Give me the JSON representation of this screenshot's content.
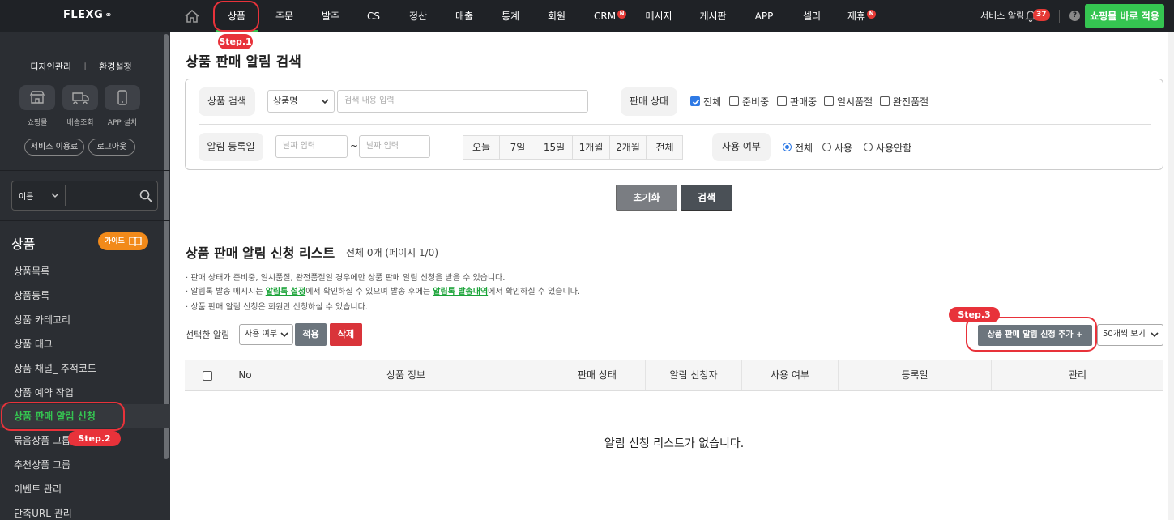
{
  "topbar": {
    "logo": "FLEXG",
    "nav": [
      {
        "label": "상품",
        "active": true
      },
      {
        "label": "주문"
      },
      {
        "label": "발주"
      },
      {
        "label": "CS"
      },
      {
        "label": "정산"
      },
      {
        "label": "매출"
      },
      {
        "label": "통계"
      },
      {
        "label": "회원"
      },
      {
        "label": "CRM",
        "badge": "N"
      },
      {
        "label": "메시지"
      },
      {
        "label": "게시판"
      },
      {
        "label": "APP"
      },
      {
        "label": "셀러"
      },
      {
        "label": "제휴",
        "badge": "N"
      }
    ],
    "service_alert": "서비스 알림",
    "alert_count": "37",
    "help": "?",
    "apply_shop": "쇼핑몰 바로 적용"
  },
  "sidebar": {
    "links": [
      "디자인관리",
      "환경설정"
    ],
    "icons": [
      {
        "label": "쇼핑몰",
        "icon": "store-icon"
      },
      {
        "label": "배송조회",
        "icon": "truck-icon"
      },
      {
        "label": "APP 설치",
        "icon": "phone-icon"
      }
    ],
    "pills": [
      "서비스 이용료",
      "로그아웃"
    ],
    "search_select": "이름",
    "section_title": "상품",
    "guide": "가이드",
    "items": [
      {
        "label": "상품목록"
      },
      {
        "label": "상품등록"
      },
      {
        "label": "상품 카테고리"
      },
      {
        "label": "상품 태그"
      },
      {
        "label": "상품 채널_ 추적코드"
      },
      {
        "label": "상품 예약 작업"
      },
      {
        "label": "상품 판매 알림 신청",
        "active": true
      },
      {
        "label": "묶음상품 그룹"
      },
      {
        "label": "추천상품 그룹"
      },
      {
        "label": "이벤트 관리"
      },
      {
        "label": "단축URL 관리"
      }
    ]
  },
  "main": {
    "title": "상품 판매 알림 검색",
    "search": {
      "product_search_label": "상품 검색",
      "product_select": "상품명",
      "keyword_placeholder": "검색 내용 입력",
      "status_label": "판매 상태",
      "status_options": [
        {
          "label": "전체",
          "checked": true
        },
        {
          "label": "준비중",
          "checked": false
        },
        {
          "label": "판매중",
          "checked": false
        },
        {
          "label": "일시품절",
          "checked": false
        },
        {
          "label": "완전품절",
          "checked": false
        }
      ],
      "date_label": "알림 등록일",
      "date_from_placeholder": "날짜 입력",
      "date_sep": "~",
      "date_to_placeholder": "날짜 입력",
      "date_buttons": [
        "오늘",
        "7일",
        "15일",
        "1개월",
        "2개월",
        "전체"
      ],
      "use_label": "사용 여부",
      "use_options": [
        {
          "label": "전체",
          "selected": true
        },
        {
          "label": "사용",
          "selected": false
        },
        {
          "label": "사용안함",
          "selected": false
        }
      ]
    },
    "reset_button": "초기화",
    "search_button": "검색",
    "list_title": "상품 판매 알림 신청 리스트",
    "list_count": "전체 0개 (페이지 1/0)",
    "notes": {
      "n1": "· 판매 상태가 준비중, 일시품절, 완전품절일 경우에만 상품 판매 알림 신청을 받을 수 있습니다.",
      "n2_pre": "· 알림톡 발송 메시지는 ",
      "n2_link1": "알림톡 설정",
      "n2_mid": "에서 확인하실 수 있으며 발송 후에는 ",
      "n2_link2": "알림톡 발송내역",
      "n2_post": "에서 확인하실 수 있습니다.",
      "n3": "· 상품 판매 알림 신청은 회원만 신청하실 수 있습니다."
    },
    "selected_label": "선택한 알림",
    "bulk_select": "사용 여부",
    "apply_button": "적용",
    "delete_button": "삭제",
    "add_button": "상품 판매 알림 신청 추가 +",
    "page_size": "50개씩 보기",
    "table": {
      "columns": [
        "No",
        "상품 정보",
        "판매 상태",
        "알림 신청자",
        "사용 여부",
        "등록일",
        "관리"
      ]
    },
    "empty_message": "알림 신청 리스트가 없습니다."
  },
  "steps": [
    "Step.1",
    "Step.2",
    "Step.3"
  ],
  "colors": {
    "accent": "#35c551",
    "step": "#e8323a",
    "topbar": "#1f2226",
    "sidebar": "#2b2e33"
  }
}
